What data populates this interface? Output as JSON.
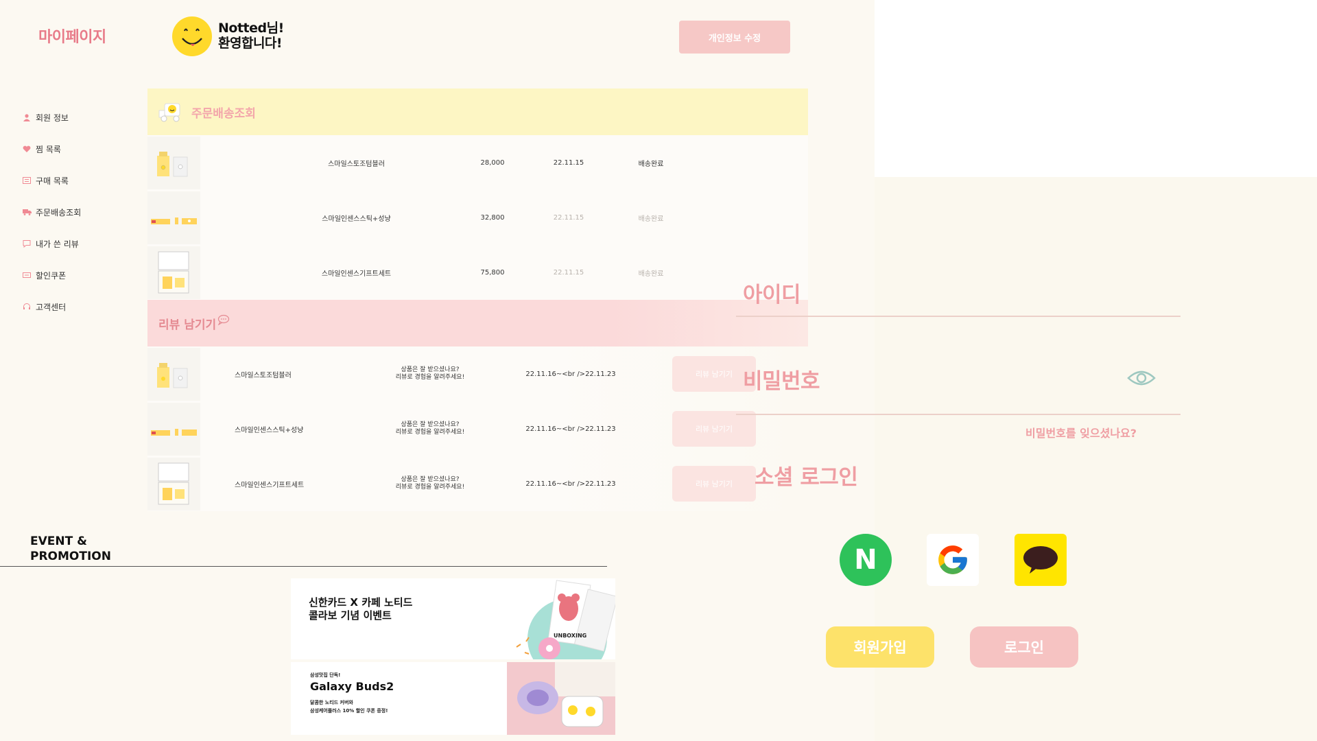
{
  "header": {
    "title": "마이페이지",
    "welcome_line1": "Notted님!",
    "welcome_line2": "환영합니다!",
    "edit_button": "개인정보 수정"
  },
  "sidebar": {
    "items": [
      {
        "label": "회원 정보",
        "icon": "user-icon"
      },
      {
        "label": "찜 목록",
        "icon": "heart-icon"
      },
      {
        "label": "구매 목록",
        "icon": "list-icon"
      },
      {
        "label": "주문배송조회",
        "icon": "truck-icon"
      },
      {
        "label": "내가 쓴 리뷰",
        "icon": "chat-icon"
      },
      {
        "label": "할인쿠폰",
        "icon": "coupon-icon"
      },
      {
        "label": "고객센터",
        "icon": "headset-icon"
      }
    ]
  },
  "orders": {
    "title": "주문배송조회",
    "rows": [
      {
        "name": "스마일스토조텀블러",
        "price": "28,000",
        "date": "22.11.15",
        "status": "배송완료"
      },
      {
        "name": "스마일인센스스틱+성냥",
        "price": "32,800",
        "date": "22.11.15",
        "status": "배송완료"
      },
      {
        "name": "스마일인센스기프트세트",
        "price": "75,800",
        "date": "22.11.15",
        "status": "배송완료"
      }
    ]
  },
  "reviews": {
    "title": "리뷰 남기기",
    "rows": [
      {
        "name": "스마일스토조텀블러",
        "msg1": "상품은 잘 받으셨나요?",
        "msg2": "리뷰로 경험을 알려주세요!",
        "date": "22.11.16~<br />22.11.23",
        "button": "리뷰 남기기"
      },
      {
        "name": "스마일인센스스틱+성냥",
        "msg1": "상품은 잘 받으셨나요?",
        "msg2": "리뷰로 경험을 알려주세요!",
        "date": "22.11.16~<br />22.11.23",
        "button": "리뷰 남기기"
      },
      {
        "name": "스마일인센스기프트세트",
        "msg1": "상품은 잘 받으셨나요?",
        "msg2": "리뷰로 경험을 알려주세요!",
        "date": "22.11.16~<br />22.11.23",
        "button": "리뷰 남기기"
      }
    ]
  },
  "event": {
    "title_line1": "EVENT &",
    "title_line2": "PROMOTION",
    "card1_line1": "신한카드 X 카페 노티드",
    "card1_line2": "콜라보 기념 이벤트",
    "card1_img_text": "UNBOXING",
    "card2_small": "삼성맛집 단독!",
    "card2_title": "Galaxy Buds2",
    "card2_desc1": "달콤한 노티드 커버와",
    "card2_desc2": "삼성케어플러스 10% 할인 쿠폰 증정!"
  },
  "login": {
    "id_label": "아이디",
    "pw_label": "비밀번호",
    "forgot": "비밀번호를 잊으셨나요?",
    "social_label": "소셜 로그인",
    "naver_letter": "N",
    "join_button": "회원가입",
    "login_button": "로그인"
  },
  "colors": {
    "accent_pink": "#e87b89",
    "order_header_bg": "#fdf6c4",
    "review_header_bg": "#fbdada",
    "naver_green": "#2ec25a",
    "kakao_yellow": "#ffe500"
  }
}
